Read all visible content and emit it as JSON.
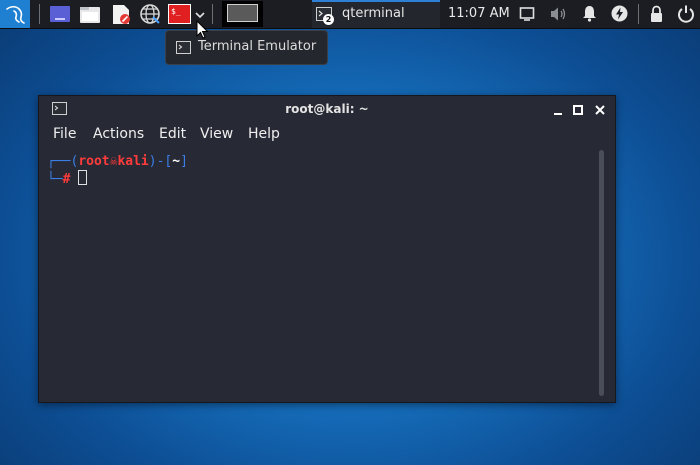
{
  "panel": {
    "clock": "11:07 AM",
    "task_label": "qterminal",
    "task_badge": "2"
  },
  "tooltip": {
    "text": "Terminal Emulator"
  },
  "window": {
    "title": "root@kali: ~",
    "menu": [
      "File",
      "Actions",
      "Edit",
      "View",
      "Help"
    ]
  },
  "terminal": {
    "user": "root",
    "host": "kali",
    "path": "~",
    "prompt_symbol": "#"
  },
  "colors": {
    "accent": "#2e7fd6",
    "prompt_red": "#ff3b3b",
    "prompt_blue": "#3b7ee8"
  }
}
